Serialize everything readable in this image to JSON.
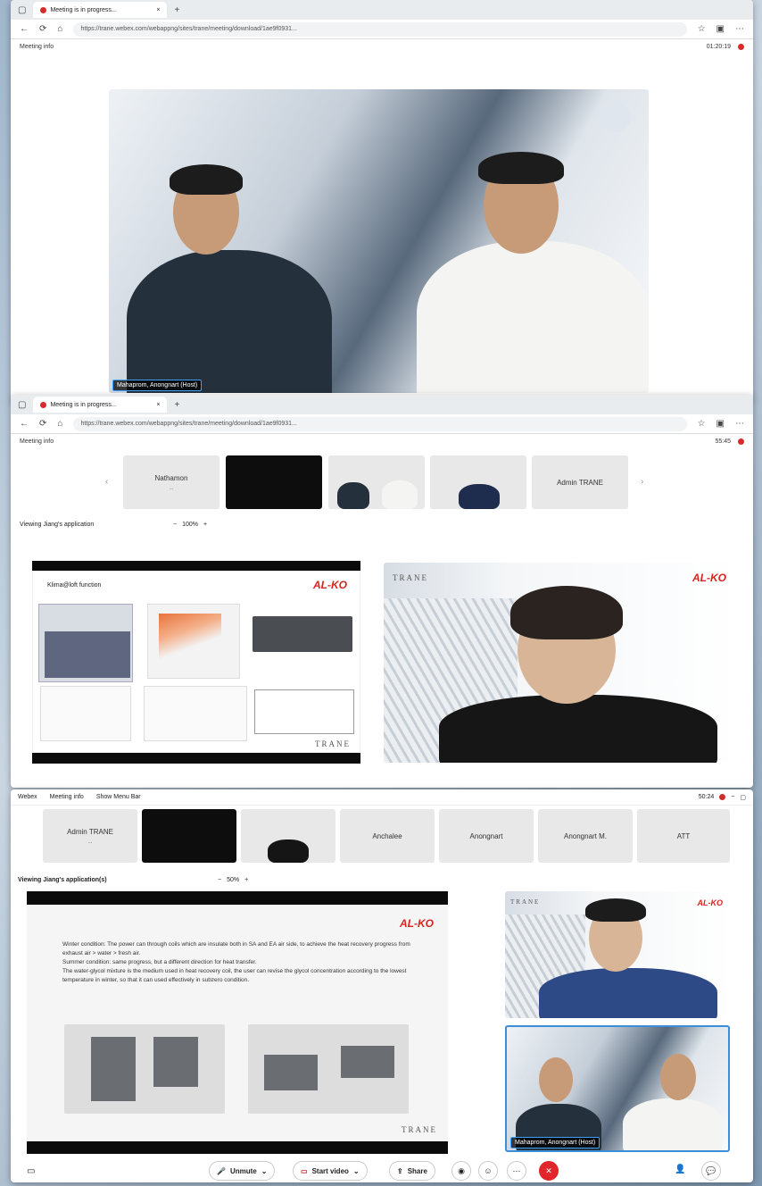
{
  "window1": {
    "tab_title": "Meeting is in progress...",
    "url": "https://trane.webex.com/webappng/sites/trane/meeting/download/1ae9f0931...",
    "meeting_info": "Meeting info",
    "timer": "01:20:19",
    "host_label": "Mahaprom, Anongnart (Host)"
  },
  "window2": {
    "tab_title": "Meeting is in progress...",
    "url": "https://trane.webex.com/webappng/sites/trane/meeting/download/1ae9f0931...",
    "meeting_info": "Meeting info",
    "timer": "55:45",
    "thumbnails": [
      {
        "name": "Nathamon",
        "sub": "..."
      },
      {
        "name": "",
        "sub": ""
      },
      {
        "name": "",
        "sub": ""
      },
      {
        "name": "",
        "sub": ""
      },
      {
        "name": "Admin TRANE",
        "sub": ""
      }
    ],
    "viewing_label": "Viewing Jiang's application",
    "zoom": "100%",
    "slide_title": "Klima@loft function",
    "alko_logo": "AL-KO",
    "trane_logo": "TRANE"
  },
  "window3": {
    "app_name": "Webex",
    "meeting_info": "Meeting info",
    "show_menu": "Show Menu Bar",
    "timer": "50:24",
    "thumbnails": [
      {
        "name": "Admin TRANE",
        "sub": "..."
      },
      {
        "name": ""
      },
      {
        "name": ""
      },
      {
        "name": "Anchalee"
      },
      {
        "name": "Anongnart"
      },
      {
        "name": "Anongnart M."
      },
      {
        "name": "ATT"
      }
    ],
    "viewing_label": "Viewing Jiang's application(s)",
    "zoom": "50%",
    "slide_bullets": [
      "Winter condition: The power can through coils which are insulate both in SA and EA air side, to achieve the heat recovery progress from exhaust air > water > fresh air.",
      "Summer condition: same progress, but a different direction for heat transfer.",
      "The water-glycol mixture is the medium used in heat recovery coil, the user can revise the glycol concentration according to the lowest temperature in winter, so that it can used effectively in subzero condition."
    ],
    "alko_logo": "AL-KO",
    "trane_logo": "TRANE",
    "host_label": "Mahaprom, Anongnart (Host)",
    "controls": {
      "unmute": "Unmute",
      "start_video": "Start video",
      "share": "Share"
    },
    "colors": {
      "end_call": "#e0252b",
      "accent": "#3a8fd8"
    }
  }
}
